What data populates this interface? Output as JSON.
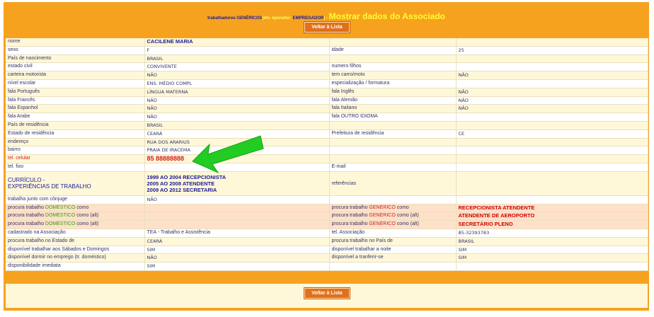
{
  "header": {
    "prefix": "trabalhadores GENÉRICOS",
    "operator": "(div. operador: ",
    "operator_name": "EMPREGADOR",
    "operator_close": ") - ",
    "title": "Mostrar dados do Associado"
  },
  "buttons": {
    "back_top": "Voltar à Lista",
    "back_bottom": "Voltar à Lista"
  },
  "rows": {
    "nome_label": "nome",
    "nome_value": "CACILENE MARIA",
    "sexo_label": "sexo",
    "sexo_value": "F",
    "idade_label": "idade",
    "idade_value": "25",
    "pais_nasc_label": "País de nascimento",
    "pais_nasc_value": "BRASIL",
    "estado_civil_label": "estado civil",
    "estado_civil_value": "CONVIVENTE",
    "filhos_label": "numero filhos",
    "filhos_value": "",
    "carteira_label": "carteira motorista",
    "carteira_value": "NÃO",
    "carro_label": "tem carro/moto",
    "carro_value": "NÃO",
    "escolar_label": "nível escolar",
    "escolar_value": "ENS. MÉDIO COMPL",
    "especial_label": "especialização / formatura",
    "especial_value": "",
    "port_label": "fala Português",
    "port_value": "LÍNGUA MATERNA",
    "ingles_label": "fala Inglês",
    "ingles_value": "NÃO",
    "frances_label": "fala Francês",
    "frances_value": "NÃO",
    "alemao_label": "fala Alemão",
    "alemao_value": "NÃO",
    "espanhol_label": "fala Espanhol",
    "espanhol_value": "NÃO",
    "italiano_label": "fala Italiano",
    "italiano_value": "NÃO",
    "arabe_label": "fala Arabe",
    "arabe_value": "NÃO",
    "outro_label": "fala OUTRO IDIOMA",
    "outro_value": "",
    "pais_res_label": "País de residência",
    "pais_res_value": "BRASIL",
    "estado_res_label": "Estado de residência",
    "estado_res_value": "CEARÁ",
    "prefeitura_label": "Prefeitura de residência",
    "prefeitura_value": "CE",
    "endereco_label": "endereço",
    "endereco_value": "RUA DOS ARARIUS",
    "bairro_label": "bairro",
    "bairro_value": "PRAIA DE IRACEMA",
    "celular_label": "tel. celular",
    "celular_value": "85 88888888",
    "fixo_label": "tel. fixo",
    "fixo_value": "",
    "email_label": "E-mail",
    "email_value": "",
    "curriculo_label_1": "CURRÍCULO -",
    "curriculo_label_2": "EXPERIÊNCIAS DE TRABALHO",
    "curriculo_value_1": "1999 AO 2004 RECEPCIONISTA",
    "curriculo_value_2": "2005 AO 2008 ATENDENTE",
    "curriculo_value_3": "2009 AO 2012 SECRETARIA",
    "referencias_label": "referências",
    "conjuge_label": "trabalha junto com cônjuge",
    "conjuge_value": "NÃO",
    "procura_label": "procura trabalho ",
    "domestico": "DOMÉSTICO",
    "generico": "GENÉRICO",
    "como": " como",
    "como_alt": " como (alt)",
    "gen_value_1": "RECEPCIONISTA ATENDENTE",
    "gen_value_2": "ATENDENTE DE AEROPORTO",
    "gen_value_3": "SECRETÁRIO PLENO",
    "cadastrado_label": "cadastrado na Associação",
    "cadastrado_value": "TEA - Trabalho e Assistência",
    "tel_assoc_label": "tel. Associação",
    "tel_assoc_value": "85-32393783",
    "estado_proc_label": "procura trabalho no Estado de",
    "estado_proc_value": "CEARÁ",
    "pais_proc_label": "procura trabalho no País de",
    "pais_proc_value": "BRASIL",
    "sabados_label": "disponível trabalhar aos Sábados e Domingos",
    "sabados_value": "SIM",
    "noite_label": "disponível trabalhar a noite",
    "noite_value": "SIM",
    "dormir_label": "disponível dormir no emprego (tr. doméstico)",
    "dormir_value": "NÃO",
    "transferir_label": "disponível a tranferir-se",
    "transferir_value": "SIM",
    "imediata_label": "disponibilidade imediata",
    "imediata_value": "SIM"
  },
  "colors": {
    "frame": "#f6a21e",
    "button": "#e0701a",
    "title": "#ffff33",
    "arrow": "#22cc22",
    "highlight": "#d21c1c"
  }
}
